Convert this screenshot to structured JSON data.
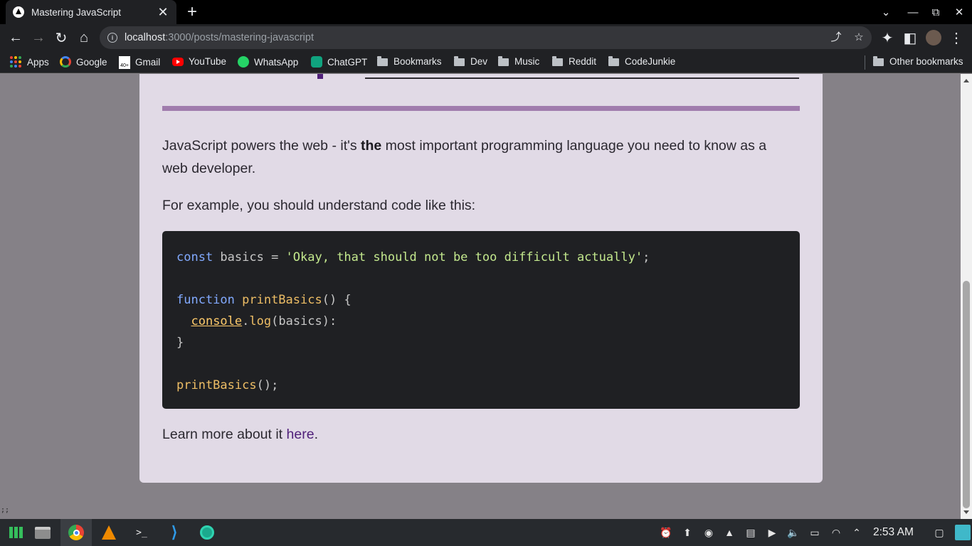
{
  "browser": {
    "tab_title": "Mastering JavaScript",
    "url_host": "localhost",
    "url_path": ":3000/posts/mastering-javascript",
    "bookmarks": [
      {
        "label": "Apps"
      },
      {
        "label": "Google"
      },
      {
        "label": "Gmail"
      },
      {
        "label": "YouTube"
      },
      {
        "label": "WhatsApp"
      },
      {
        "label": "ChatGPT"
      },
      {
        "label": "Bookmarks"
      },
      {
        "label": "Dev"
      },
      {
        "label": "Music"
      },
      {
        "label": "Reddit"
      },
      {
        "label": "CodeJunkie"
      }
    ],
    "other_bookmarks": "Other bookmarks",
    "gmail_badge": "40+"
  },
  "article": {
    "intro_before": "JavaScript powers the web - it's ",
    "intro_bold": "the",
    "intro_after": " most important programming language you need to know as a web developer.",
    "example_text": "For example, you should understand code like this:",
    "code": {
      "line1_kw": "const",
      "line1_rest": " basics = ",
      "line1_str": "'Okay, that should not be too difficult actually'",
      "line1_end": ";",
      "line3_kw": "function",
      "line3_fn": " printBasics",
      "line3_end": "() {",
      "line4_indent": "  ",
      "line4_obj": "console",
      "line4_dot": ".",
      "line4_method": "log",
      "line4_end": "(basics):",
      "line5": "}",
      "line7_fn": "printBasics",
      "line7_end": "();"
    },
    "learn_more_before": "Learn more about it ",
    "learn_more_link": "here",
    "learn_more_after": "."
  },
  "corner_text": ";;",
  "taskbar": {
    "clock": "2:53 AM",
    "apps": [
      "manjaro-icon",
      "files-icon",
      "chrome-icon",
      "vlc-icon",
      "terminal-icon",
      "vscode-icon",
      "aperture-icon"
    ]
  },
  "colors": {
    "accent_purple": "#50207a",
    "rule_purple": "#a07cad",
    "card_bg": "#e1dae6",
    "code_bg": "#1f2023"
  }
}
